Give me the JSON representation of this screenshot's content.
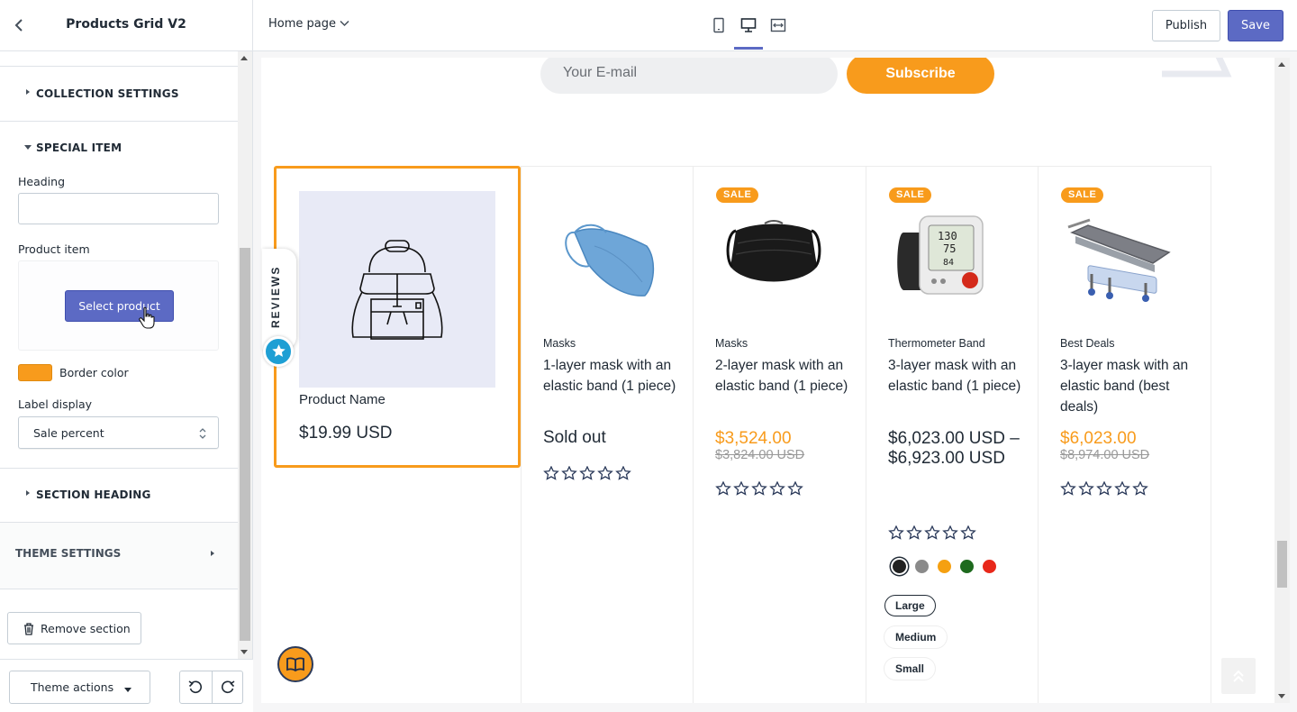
{
  "sidebar": {
    "title": "Products Grid V2",
    "sections": {
      "collection_settings": "COLLECTION SETTINGS",
      "special_item": "SPECIAL ITEM",
      "section_heading": "SECTION HEADING"
    },
    "fields": {
      "heading_label": "Heading",
      "heading_value": "",
      "product_item_label": "Product item",
      "select_product_label": "Select product",
      "border_color_label": "Border color",
      "border_color": "#f89b1c",
      "label_display_label": "Label display",
      "label_display_value": "Sale percent"
    },
    "theme_settings": "THEME SETTINGS",
    "remove_section": "Remove section",
    "theme_actions": "Theme actions"
  },
  "topbar": {
    "page_selector": "Home page",
    "publish_label": "Publish",
    "save_label": "Save"
  },
  "preview": {
    "email_placeholder": "Your E-mail",
    "subscribe_label": "Subscribe",
    "reviews_tab": "REVIEWS",
    "special_item": {
      "name": "Product Name",
      "price": "$19.99 USD"
    },
    "products": [
      {
        "vendor": "Masks",
        "title": "1-layer mask with an elastic band (1 piece)",
        "status": "Sold out",
        "image": "blue-mask"
      },
      {
        "badge": "SALE",
        "vendor": "Masks",
        "title": "2-layer mask with an elastic band (1 piece)",
        "price": "$3,524.00",
        "compare_price": "$3,824.00 USD",
        "image": "black-mask"
      },
      {
        "badge": "SALE",
        "vendor": "Thermometer Band",
        "title": "3-layer mask with an elastic band (1 piece)",
        "price_range": "$6,023.00 USD – $6,923.00 USD",
        "image": "blood-pressure-monitor",
        "colors": [
          "#222222",
          "#8a8a8a",
          "#f5a011",
          "#1e6a1e",
          "#e8281a"
        ],
        "sizes": [
          "Large",
          "Medium",
          "Small"
        ]
      },
      {
        "badge": "SALE",
        "vendor": "Best Deals",
        "title": "3-layer mask with an elastic band (best deals)",
        "price": "$6,023.00",
        "compare_price": "$8,974.00 USD",
        "image": "hospital-stretcher"
      }
    ],
    "accent_color": "#f89b1c",
    "brand_color": "#5c6ac4"
  }
}
